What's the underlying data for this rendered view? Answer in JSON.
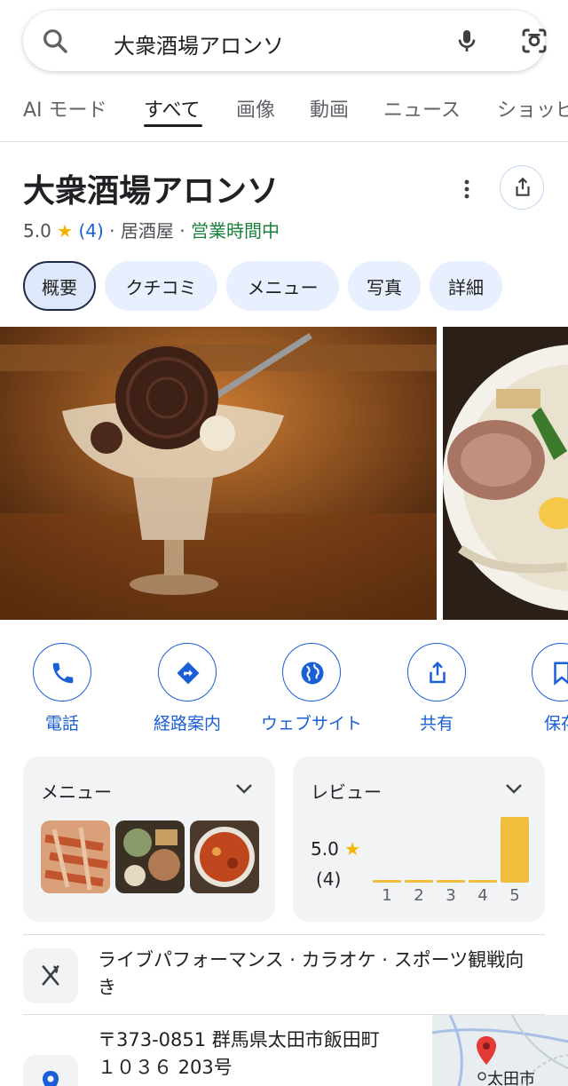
{
  "search": {
    "query": "大衆酒場アロンソ"
  },
  "tabs": [
    "AI モード",
    "すべて",
    "画像",
    "動画",
    "ニュース",
    "ショッピ"
  ],
  "place": {
    "name": "大衆酒場アロンソ",
    "rating": "5.0",
    "review_count": "(4)",
    "category": "居酒屋",
    "status": "営業時間中"
  },
  "chips": [
    "概要",
    "クチコミ",
    "メニュー",
    "写真",
    "詳細"
  ],
  "actions": [
    "電話",
    "経路案内",
    "ウェブサイト",
    "共有",
    "保存"
  ],
  "menu_card": {
    "title": "メニュー"
  },
  "reviews_card": {
    "title": "レビュー",
    "score": "5.0",
    "count": "(4)",
    "distribution": [
      {
        "stars": "1",
        "fraction": 0.0
      },
      {
        "stars": "2",
        "fraction": 0.0
      },
      {
        "stars": "3",
        "fraction": 0.0
      },
      {
        "stars": "4",
        "fraction": 0.0
      },
      {
        "stars": "5",
        "fraction": 1.0
      }
    ]
  },
  "info": {
    "features": "ライブパフォーマンス · カラオケ · スポーツ観戦向き",
    "address_line1": "〒373-0851 群馬県太田市飯田町",
    "address_line2": "１０３６ 203号",
    "map_label": "太田市"
  },
  "colors": {
    "accent": "#1a5fd6",
    "open": "#188038",
    "star": "#f4b400",
    "bar": "#f0be3c"
  }
}
